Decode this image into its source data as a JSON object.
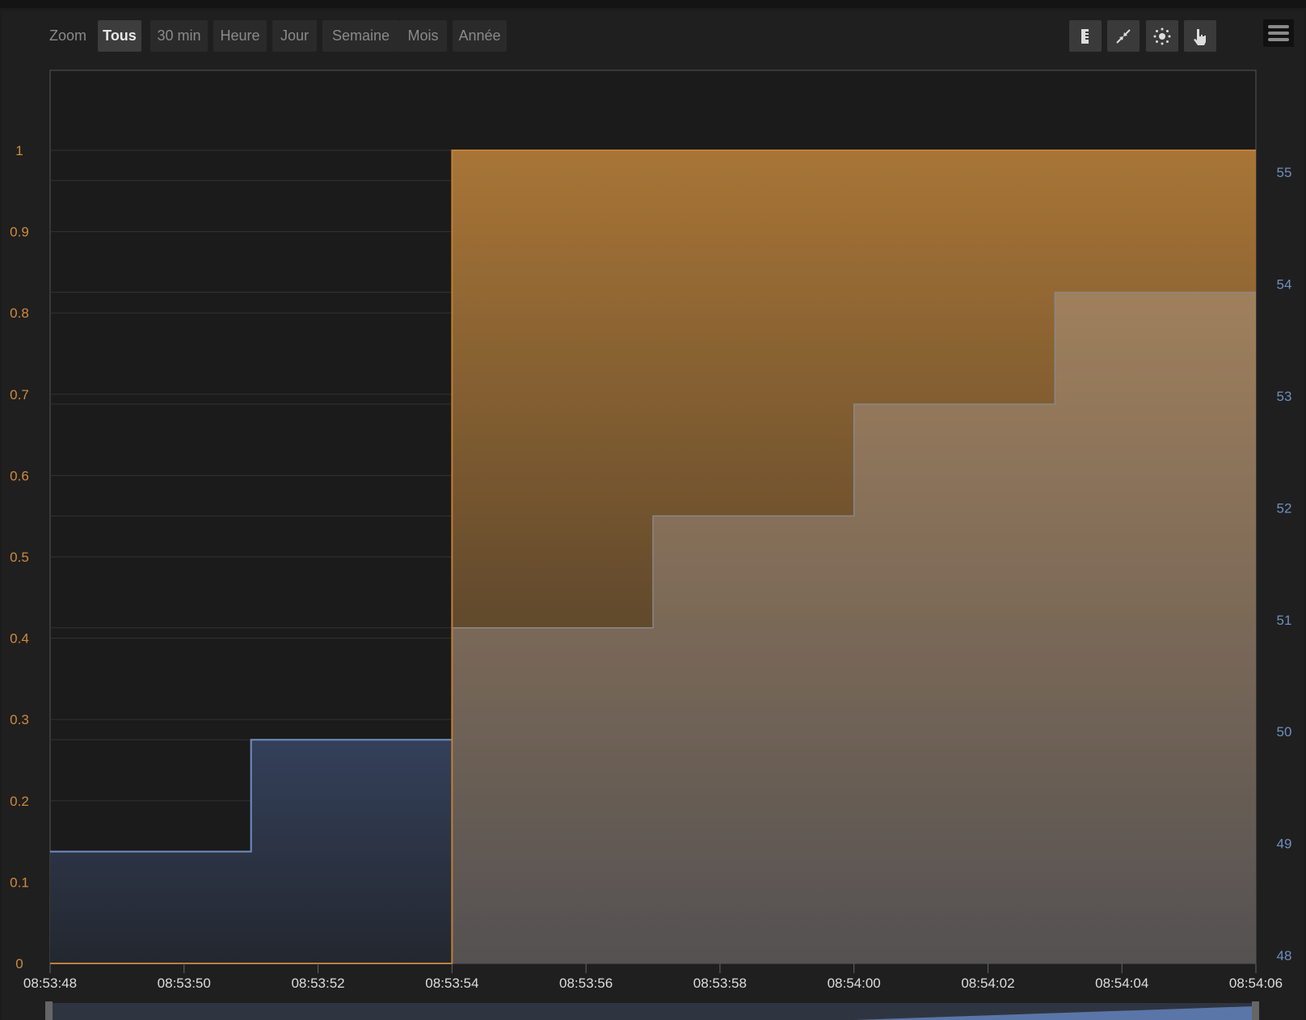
{
  "toolbar": {
    "zoom_label": "Zoom",
    "ranges": [
      "Tous",
      "30 min",
      "Heure",
      "Jour",
      "Semaine",
      "Mois",
      "Année"
    ],
    "selected": "Tous",
    "icons": [
      "ruler-icon",
      "compress-icon",
      "sun-icon",
      "hand-pointer-icon"
    ],
    "menu_icon": "hamburger-menu-icon"
  },
  "colors": {
    "orange": "#c0803a",
    "blue": "#6f8fc0",
    "orange_label": "#d08a3a",
    "blue_label": "#6f8fc0"
  },
  "chart_data": {
    "type": "area",
    "step": true,
    "x_ticks": [
      "08:53:48",
      "08:53:50",
      "08:53:52",
      "08:53:54",
      "08:53:56",
      "08:53:58",
      "08:54:00",
      "08:54:02",
      "08:54:04",
      "08:54:06"
    ],
    "x_range_seconds": [
      0,
      18
    ],
    "left_axis": {
      "ticks": [
        "0",
        "0.1",
        "0.2",
        "0.3",
        "0.4",
        "0.5",
        "0.6",
        "0.7",
        "0.8",
        "0.9",
        "1"
      ],
      "ylim": [
        0,
        1.1
      ]
    },
    "right_axis": {
      "ticks": [
        "48",
        "49",
        "50",
        "51",
        "52",
        "53",
        "54",
        "55"
      ],
      "ylim": [
        48,
        56
      ]
    },
    "series": [
      {
        "name": "orange",
        "axis": "left",
        "points": [
          [
            0,
            0
          ],
          [
            6,
            1
          ],
          [
            18,
            1
          ]
        ]
      },
      {
        "name": "blue",
        "axis": "right",
        "points": [
          [
            0,
            49
          ],
          [
            3,
            50
          ],
          [
            6,
            51
          ],
          [
            9,
            52
          ],
          [
            12,
            53
          ],
          [
            15,
            54
          ],
          [
            18,
            54
          ]
        ]
      }
    ],
    "legend": "none",
    "grid": true
  }
}
